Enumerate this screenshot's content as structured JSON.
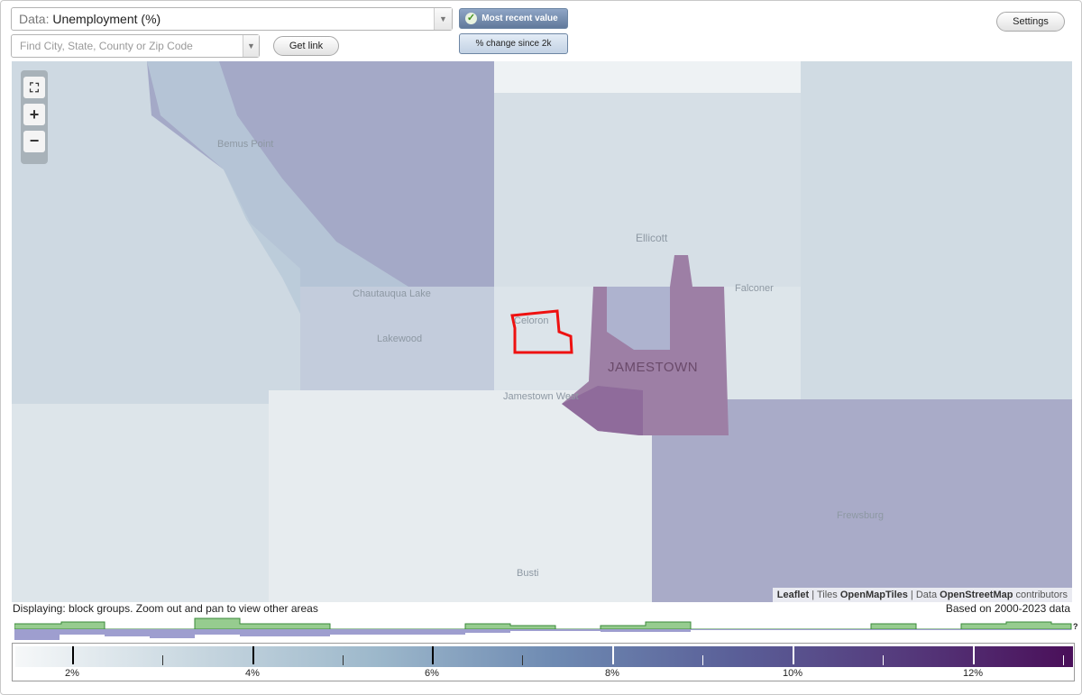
{
  "data_select": {
    "label": "Data:",
    "value": "Unemployment (%)"
  },
  "search": {
    "placeholder": "Find City, State, County or Zip Code"
  },
  "buttons": {
    "get_link": "Get link",
    "settings": "Settings"
  },
  "view_toggle": {
    "most_recent": "Most recent value",
    "change_since": "% change since 2k",
    "selected": "most_recent"
  },
  "zoom": {
    "full": "⛶",
    "in": "+",
    "out": "−"
  },
  "map": {
    "places": [
      "Ellicott",
      "Falconer",
      "Celoron",
      "Lakewood",
      "Jamestown West",
      "JAMESTOWN",
      "Frewsburg",
      "Busti",
      "Bemus Point",
      "Chautauqua Lake"
    ],
    "highlight_color": "#ee1111",
    "attribution": {
      "leaflet": "Leaflet",
      "tiles_label": "Tiles",
      "tiles": "OpenMapTiles",
      "data_label": "Data",
      "data": "OpenStreetMap",
      "contributors": "contributors"
    }
  },
  "status": {
    "displaying": "Displaying: block groups. Zoom out and pan to view other areas",
    "based_on": "Based on 2000-2023 data"
  },
  "legend": {
    "labels": [
      "2%",
      "4%",
      "6%",
      "8%",
      "10%",
      "12%"
    ],
    "unknown": "?"
  }
}
